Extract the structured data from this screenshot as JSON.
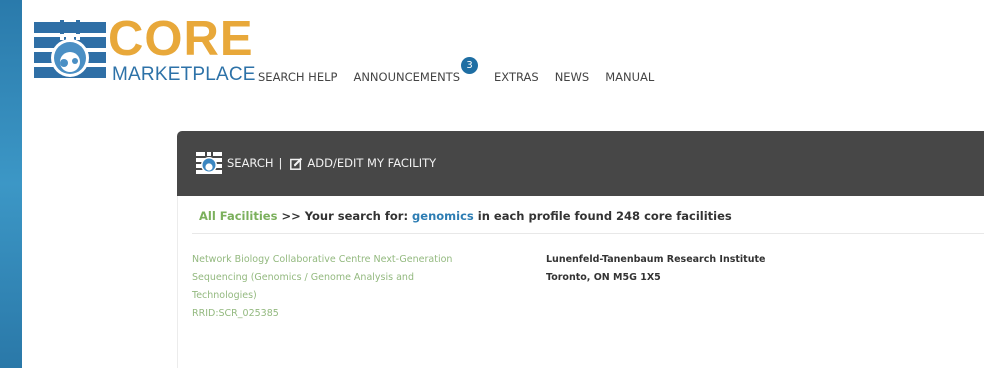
{
  "brand": {
    "title": "CORE",
    "subtitle": "MARKETPLACE",
    "core_color": "#e8a83a",
    "market_color": "#2d72a8"
  },
  "nav": {
    "items": [
      {
        "label": "SEARCH HELP"
      },
      {
        "label": "ANNOUNCEMENTS",
        "badge": "3"
      },
      {
        "label": "EXTRAS"
      },
      {
        "label": "NEWS"
      },
      {
        "label": "MANUAL"
      }
    ]
  },
  "toolbar": {
    "search_label": "SEARCH",
    "separator": "|",
    "edit_label": "ADD/EDIT MY FACILITY",
    "background": "#474747"
  },
  "results": {
    "breadcrumb_link": "All Facilities",
    "text_before": " >> Your search for: ",
    "term": "genomics",
    "text_after": " in each profile found 248 core facilities"
  },
  "facility": {
    "name": "Network Biology Collaborative Centre Next-Generation Sequencing (Genomics / Genome Analysis and Technologies)",
    "rrid": "RRID:SCR_025385",
    "institution": "Lunenfeld-Tanenbaum Research Institute",
    "location": "Toronto, ON M5G 1X5"
  },
  "icons": {
    "logo": "core-marketplace-logo-icon",
    "search": "core-marketplace-mini-icon",
    "edit": "edit-square-icon"
  }
}
